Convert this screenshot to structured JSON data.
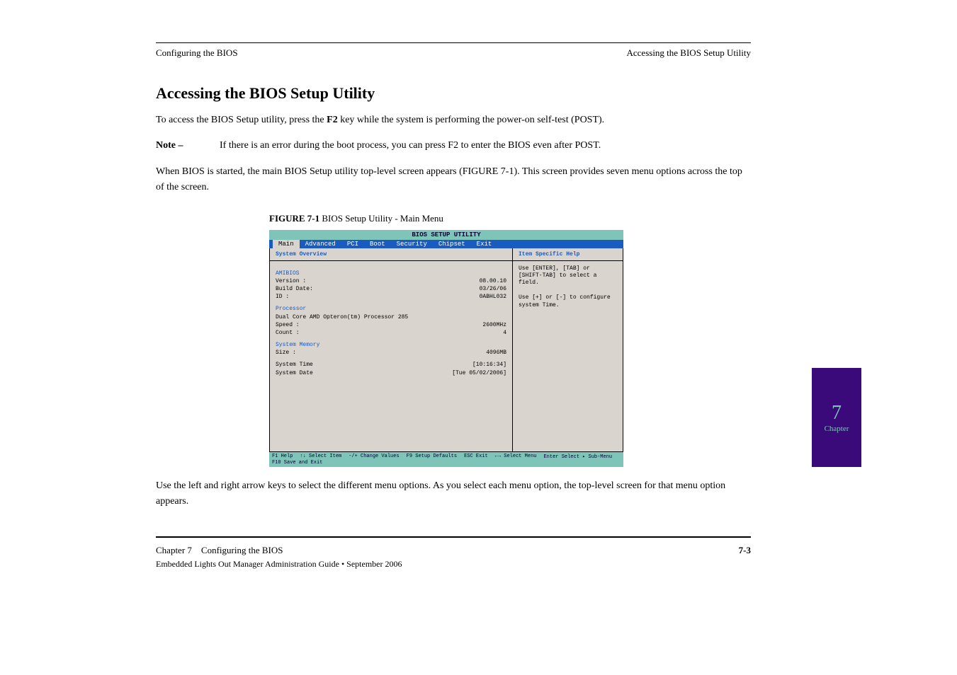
{
  "header": {
    "left": "Configuring the BIOS",
    "right": "Accessing the BIOS Setup Utility"
  },
  "section": {
    "heading": "Accessing the BIOS Setup Utility",
    "para1_a": "To access the BIOS Setup utility, press the ",
    "para1_key": "F2",
    "para1_b": " key while the system is performing the power-on self-test (POST)."
  },
  "note": {
    "label": "Note –",
    "text": "If there is an error during the boot process, you can press F2 to enter the BIOS even after POST."
  },
  "paragraph2": "When BIOS is started, the main BIOS Setup utility top-level screen appears (FIGURE 7-1). This screen provides seven menu options across the top of the screen.",
  "figure": {
    "number": "FIGURE 7-1",
    "caption": "BIOS Setup Utility - Main Menu"
  },
  "bios": {
    "title": "BIOS SETUP UTILITY",
    "tabs": [
      "Main",
      "Advanced",
      "PCI",
      "Boot",
      "Security",
      "Chipset",
      "Exit"
    ],
    "left_header": "System Overview",
    "right_header": "Item Specific Help",
    "ami": "AMIBIOS",
    "version_label": "Version :",
    "version_value": "08.00.10",
    "build_label": "Build Date:",
    "build_value": "03/26/06",
    "id_label": "ID :",
    "id_value": "0ABHL032",
    "processor": "Processor",
    "proc_line": "Dual Core AMD Opteron(tm) Processor 285",
    "speed_label": "Speed :",
    "speed_value": "2600MHz",
    "count_label": "Count :",
    "count_value": "4",
    "sysmem": "System Memory",
    "size_label": "Size :",
    "size_value": "4096MB",
    "time_label": "System Time",
    "time_value": "[10:16:34]",
    "date_label": "System Date",
    "date_value": "[Tue 05/02/2006]",
    "help_text": "Use [ENTER], [TAB] or [SHIFT-TAB] to select a field.\n\nUse [+] or [-] to configure system Time.",
    "footer": {
      "f1": "F1 Help",
      "arrows": "↑↓ Select Item",
      "pm": "-/+ Change Values",
      "f9": "F9 Setup Defaults",
      "esc": "ESC Exit",
      "lr": "←→ Select Menu",
      "enter": "Enter Select ▸ Sub-Menu",
      "f10": "F10 Save and Exit"
    }
  },
  "trailing": "Use the left and right arrow keys to select the different menu options. As you select each menu option, the top-level screen for that menu option appears.",
  "sidebar": {
    "num": "7",
    "word": "Chapter"
  },
  "footer": {
    "left": "Chapter 7",
    "center": "Configuring the BIOS",
    "page": "7-3",
    "doc": "Embedded Lights Out Manager Administration Guide • September 2006"
  }
}
